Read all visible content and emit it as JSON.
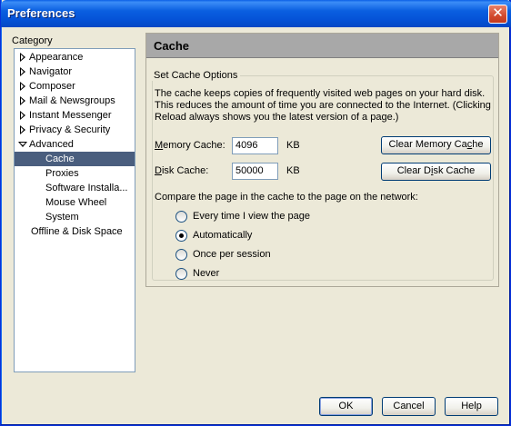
{
  "window": {
    "title": "Preferences",
    "close_glyph": "✕"
  },
  "category": {
    "label": "Category",
    "items": [
      {
        "label": "Appearance",
        "expand": "collapsed"
      },
      {
        "label": "Navigator",
        "expand": "collapsed"
      },
      {
        "label": "Composer",
        "expand": "collapsed"
      },
      {
        "label": "Mail & Newsgroups",
        "expand": "collapsed"
      },
      {
        "label": "Instant Messenger",
        "expand": "collapsed"
      },
      {
        "label": "Privacy & Security",
        "expand": "collapsed"
      },
      {
        "label": "Advanced",
        "expand": "expanded"
      },
      {
        "label": "Cache",
        "selected": true
      },
      {
        "label": "Proxies"
      },
      {
        "label": "Software Installa..."
      },
      {
        "label": "Mouse Wheel"
      },
      {
        "label": "System"
      },
      {
        "label": "Offline & Disk Space"
      }
    ]
  },
  "cache": {
    "header": "Cache",
    "group_title": "Set Cache Options",
    "description": "The cache keeps copies of frequently visited web pages on your hard disk. This reduces the amount of time you are connected to the Internet. (Clicking Reload always shows you the latest version of a page.)",
    "memory_label_first": "M",
    "memory_label_rest": "emory Cache:",
    "memory_value": "4096",
    "memory_unit": "KB",
    "clear_memory_pre": "Clear Memory Ca",
    "clear_memory_u": "c",
    "clear_memory_post": "he",
    "disk_label_first": "D",
    "disk_label_rest": "isk Cache:",
    "disk_value": "50000",
    "disk_unit": "KB",
    "clear_disk_pre": "Clear D",
    "clear_disk_u": "i",
    "clear_disk_post": "sk Cache",
    "compare_label": "Compare the page in the cache to the page on the network:",
    "options": [
      {
        "label": "Every time I view the page",
        "checked": false
      },
      {
        "label": "Automatically",
        "checked": true
      },
      {
        "label": "Once per session",
        "checked": false
      },
      {
        "label": "Never",
        "checked": false
      }
    ]
  },
  "footer": {
    "ok": "OK",
    "cancel": "Cancel",
    "help": "Help"
  }
}
